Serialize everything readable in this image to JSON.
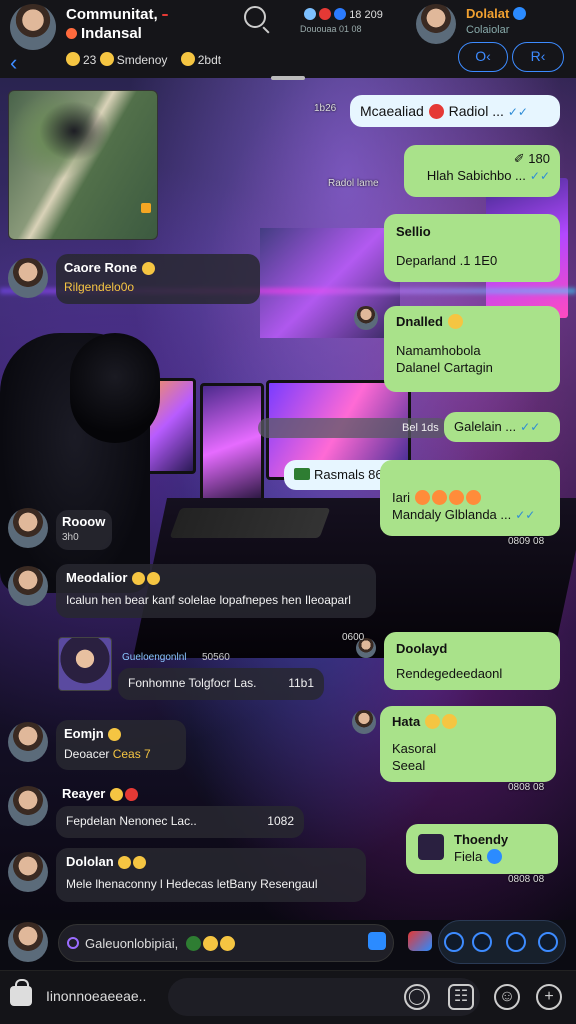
{
  "header": {
    "title": "Communitat,",
    "badge": "",
    "subtitle": "Indansal",
    "meta_count": "23",
    "meta_label": "Smdenoy",
    "meta_tail": "2bdt",
    "stats_line": "18 209",
    "stats_sub": "Dououaa 01 08",
    "contact_name": "Dolalat",
    "contact_sub": "Colaiolar",
    "btn_left": "O‹",
    "btn_right": "R‹"
  },
  "messages": [
    {
      "id": "m1",
      "type": "out",
      "time": "1b26",
      "text": "Mcaealiad",
      "text2": "Radiol ..."
    },
    {
      "id": "m2",
      "type": "out",
      "text": "✐ 180",
      "text2": "Hlah Sabichbo ..."
    },
    {
      "id": "m3",
      "type": "out",
      "time": "Radol lame",
      "title": "Sellio",
      "text": "Deparland .1 1E0"
    },
    {
      "id": "m4",
      "type": "in",
      "sender": "Caore Rone",
      "text": "Rilgendelo0o"
    },
    {
      "id": "m5",
      "type": "out",
      "title": "Dnalled",
      "text": "Namamhobola",
      "text2": "Dalanel Cartagin"
    },
    {
      "id": "m6",
      "type": "out",
      "time": "Bel 1ds",
      "text": "Galelain ..."
    },
    {
      "id": "m7",
      "type": "system",
      "text": "Rasmals 86 00 87"
    },
    {
      "id": "m8",
      "type": "out",
      "title": "Iari",
      "text": "Mandaly Glblanda ...",
      "time": "0809 08"
    },
    {
      "id": "m9",
      "type": "in",
      "sender": "Rooow",
      "text": "3h0"
    },
    {
      "id": "m10",
      "type": "in",
      "sender": "Meodalior",
      "text": "Icalun hen bear kanf solelae lopafnepes hen Ileoaparl"
    },
    {
      "id": "m11",
      "type": "in",
      "sender": "Gueloengonlnl",
      "time": "50560",
      "text": "Fonhomne Tolgfocr Las.",
      "time2": "11b1"
    },
    {
      "id": "m12",
      "type": "out",
      "title": "Doolayd",
      "text": "Rendegedeedaonl",
      "time": "0600"
    },
    {
      "id": "m13",
      "type": "in",
      "sender": "Eomjn",
      "text": "Deoacer",
      "tail": "Ceas 7"
    },
    {
      "id": "m14",
      "type": "out",
      "title": "Hata",
      "text": "Kasoral",
      "text2": "Seeal",
      "time": "0808 08"
    },
    {
      "id": "m15",
      "type": "in",
      "sender": "Reayer",
      "text": "Fepdelan Nenonec Lac..",
      "time": "1082"
    },
    {
      "id": "m16",
      "type": "out",
      "title": "Thoendy",
      "text": "Fiela",
      "time": "0808 08"
    },
    {
      "id": "m17",
      "type": "in",
      "sender": "Dololan",
      "text": "Mele lhenaconny l Hedecas letBany Resengaul"
    }
  ],
  "composer": {
    "text": "Galeuonlobipiai,"
  },
  "bottombar": {
    "text": "Iinonnoeaeeae.."
  }
}
